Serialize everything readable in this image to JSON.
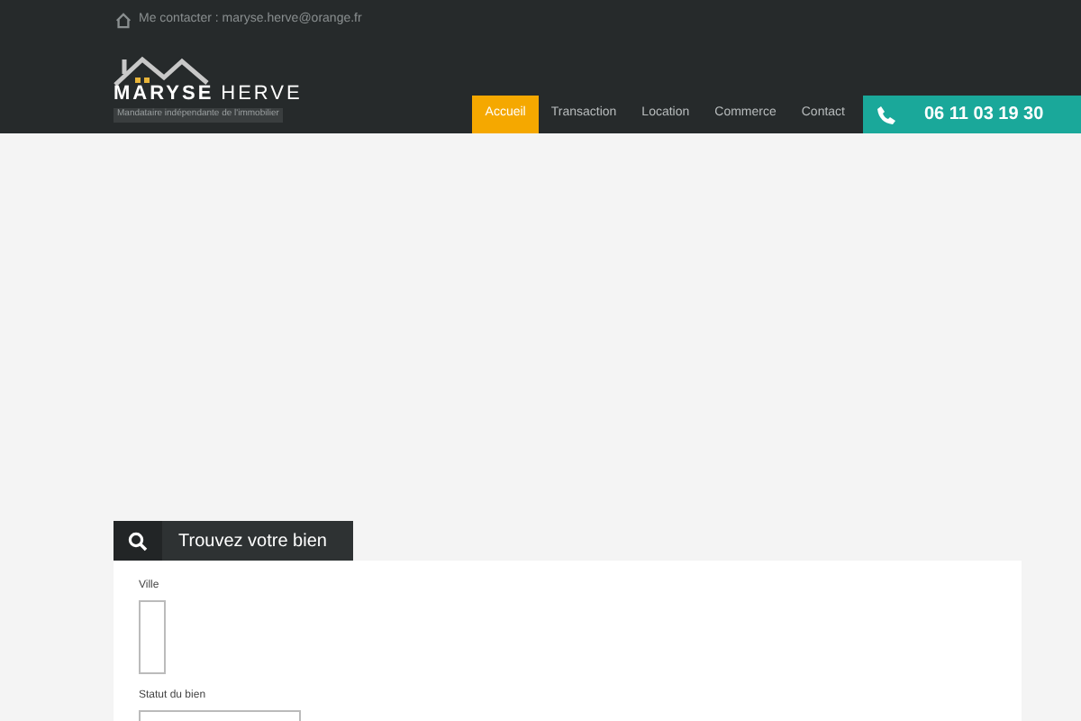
{
  "top_bar": {
    "contact": "Me contacter : maryse.herve@orange.fr"
  },
  "logo": {
    "name_bold": "MARYSE",
    "name_light": "HERVE",
    "tagline": "Mandataire indépendante de l'immobilier"
  },
  "nav": [
    {
      "label": "Accueil",
      "selected": true
    },
    {
      "label": "Transaction",
      "selected": false
    },
    {
      "label": "Location",
      "selected": false
    },
    {
      "label": "Commerce",
      "selected": false
    },
    {
      "label": "Contact",
      "selected": false
    }
  ],
  "phone": "06 11 03 19 30",
  "search": {
    "title": "Trouvez votre bien",
    "fields": [
      {
        "label": "Ville",
        "kind": "listbox"
      },
      {
        "label": "Statut du bien",
        "kind": "select"
      }
    ]
  }
}
